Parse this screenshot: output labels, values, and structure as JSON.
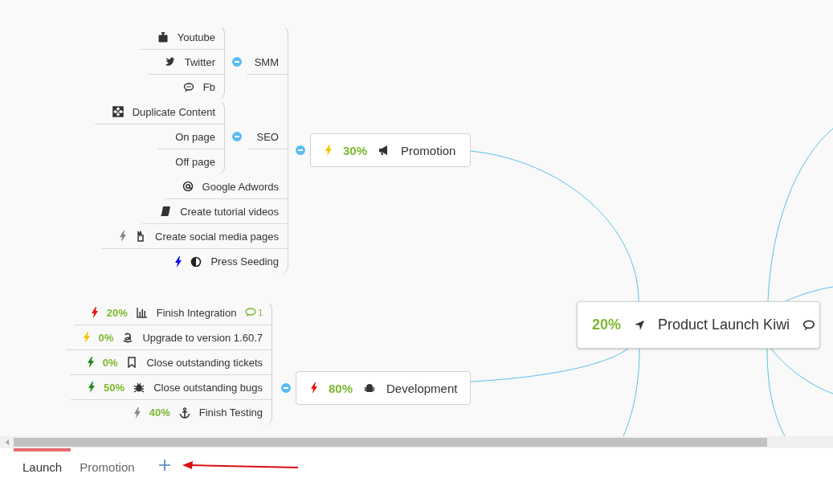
{
  "map": {
    "root": {
      "progress": "20%",
      "title": "Product Launch Kiwi",
      "has_comment": true
    },
    "branches": [
      {
        "title": "Promotion",
        "progress": "30%",
        "color": "#f7c600",
        "expanded": true,
        "children": [
          {
            "title": "SMM",
            "expanded": true,
            "children": [
              {
                "title": "Youtube"
              },
              {
                "title": "Twitter"
              },
              {
                "title": "Fb"
              }
            ]
          },
          {
            "title": "SEO",
            "expanded": true,
            "children": [
              {
                "title": "Duplicate Content"
              },
              {
                "title": "On page"
              },
              {
                "title": "Off page"
              }
            ]
          },
          {
            "title": "Google Adwords"
          },
          {
            "title": "Create tutorial videos"
          },
          {
            "title": "Create social media pages",
            "color": "#888888"
          },
          {
            "title": "Press Seeding",
            "color": "#1010ee"
          }
        ]
      },
      {
        "title": "Development",
        "progress": "80%",
        "color": "#e8100e",
        "expanded": true,
        "children": [
          {
            "title": "Finish Integration",
            "progress": "20%",
            "color": "#e8100e",
            "comments": "1"
          },
          {
            "title": "Upgrade to version 1.60.7",
            "progress": "0%",
            "color": "#f7c600"
          },
          {
            "title": "Close outstanding tickets",
            "progress": "0%",
            "color": "#1f8a1f"
          },
          {
            "title": "Close outstanding bugs",
            "progress": "50%",
            "color": "#1f8a1f"
          },
          {
            "title": "Finish Testing",
            "progress": "40%",
            "color": "#888888"
          }
        ]
      }
    ]
  },
  "tabs": [
    {
      "label": "Launch",
      "selected": true
    },
    {
      "label": "Promotion",
      "selected": false
    }
  ]
}
